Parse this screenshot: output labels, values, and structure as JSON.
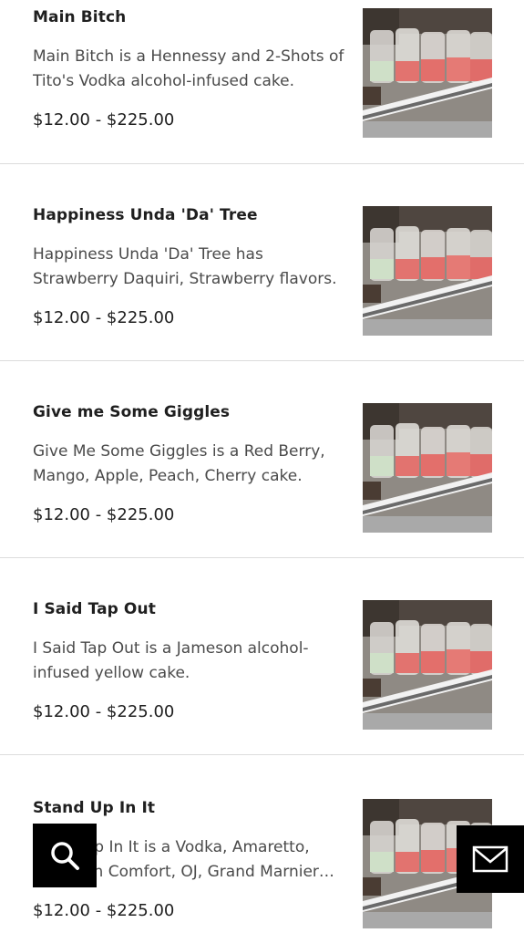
{
  "menu": {
    "items": [
      {
        "name": "Main Bitch",
        "description": "Main Bitch is a Hennessy and 2-Shots of Tito's Vodka alcohol-infused cake.",
        "price": "$12.00 - $225.00",
        "image_icon": "product-photo"
      },
      {
        "name": "Happiness Unda 'Da' Tree",
        "description": "Happiness Unda 'Da' Tree has Strawberry Daquiri, Strawberry flavors.",
        "price": "$12.00 - $225.00",
        "image_icon": "product-photo"
      },
      {
        "name": "Give me Some Giggles",
        "description": "Give Me Some Giggles is a Red Berry, Mango, Apple, Peach, Cherry cake.",
        "price": "$12.00 - $225.00",
        "image_icon": "product-photo"
      },
      {
        "name": "I Said Tap Out",
        "description": "I Said Tap Out is a Jameson alcohol-infused yellow cake.",
        "price": "$12.00 - $225.00",
        "image_icon": "product-photo"
      },
      {
        "name": "Stand Up In It",
        "description": "Stand Up In It is a Vodka, Amaretto, Southern Comfort, OJ, Grand Marnier cake.",
        "price": "$12.00 - $225.00",
        "image_icon": "product-photo"
      }
    ]
  },
  "floating_buttons": {
    "search_icon": "search-icon",
    "contact_icon": "mail-icon"
  },
  "colors": {
    "fab_background": "#000000",
    "divider": "#dcdcdc",
    "accent_pink": "#e2736f"
  }
}
